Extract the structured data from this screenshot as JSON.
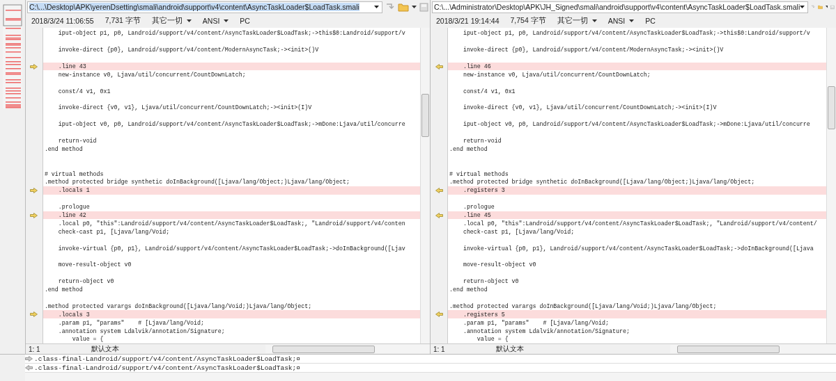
{
  "panes": [
    {
      "kind": "left",
      "path": "C:\\...\\Desktop\\APK\\yerenDsetting\\smali\\android\\support\\v4\\content\\AsyncTaskLoader$LoadTask.smali",
      "path_selected": true,
      "date": "2018/3/24 11:06:55",
      "size": "7,731 字节",
      "filter": "其它一切",
      "encoding": "ANSI",
      "line_ending": "PC",
      "lines": [
        {
          "text": "    iput-object p1, p0, Landroid/support/v4/content/AsyncTaskLoader$LoadTask;->this$0:Landroid/support/v",
          "changed": false
        },
        {
          "changed": false
        },
        {
          "text": "    invoke-direct {p0}, Landroid/support/v4/content/ModernAsyncTask;-><init>()V",
          "changed": false
        },
        {
          "changed": false
        },
        {
          "text": "    .line 43",
          "changed": true
        },
        {
          "text": "    new-instance v0, Ljava/util/concurrent/CountDownLatch;",
          "changed": false
        },
        {
          "changed": false
        },
        {
          "text": "    const/4 v1, 0x1",
          "changed": false
        },
        {
          "changed": false
        },
        {
          "text": "    invoke-direct {v0, v1}, Ljava/util/concurrent/CountDownLatch;-><init>(I)V",
          "changed": false
        },
        {
          "changed": false
        },
        {
          "text": "    iput-object v0, p0, Landroid/support/v4/content/AsyncTaskLoader$LoadTask;->mDone:Ljava/util/concurre",
          "changed": false
        },
        {
          "changed": false
        },
        {
          "text": "    return-void",
          "changed": false
        },
        {
          "text": ".end method",
          "changed": false
        },
        {
          "changed": false
        },
        {
          "changed": false
        },
        {
          "text": "# virtual methods",
          "changed": false
        },
        {
          "text": ".method protected bridge synthetic doInBackground([Ljava/lang/Object;)Ljava/lang/Object;",
          "changed": false
        },
        {
          "text": "    .locals 1",
          "changed": true
        },
        {
          "changed": false
        },
        {
          "text": "    .prologue",
          "changed": false
        },
        {
          "text": "    .line 42",
          "changed": true
        },
        {
          "text": "    .local p0, \"this\":Landroid/support/v4/content/AsyncTaskLoader$LoadTask;, \"Landroid/support/v4/conten",
          "changed": false
        },
        {
          "text": "    check-cast p1, [Ljava/lang/Void;",
          "changed": false
        },
        {
          "changed": false
        },
        {
          "text": "    invoke-virtual {p0, p1}, Landroid/support/v4/content/AsyncTaskLoader$LoadTask;->doInBackground([Ljav",
          "changed": false
        },
        {
          "changed": false
        },
        {
          "text": "    move-result-object v0",
          "changed": false
        },
        {
          "changed": false
        },
        {
          "text": "    return-object v0",
          "changed": false
        },
        {
          "text": ".end method",
          "changed": false
        },
        {
          "changed": false
        },
        {
          "text": ".method protected varargs doInBackground([Ljava/lang/Void;)Ljava/lang/Object;",
          "changed": false
        },
        {
          "text": "    .locals 3",
          "changed": true
        },
        {
          "text": "    .param p1, \"params\"    # [Ljava/lang/Void;",
          "changed": false
        },
        {
          "text": "    .annotation system Ldalvik/annotation/Signature;",
          "changed": false
        },
        {
          "text": "        value = {",
          "changed": false
        }
      ],
      "status": {
        "position": "1: 1",
        "syntax": "默认文本"
      }
    },
    {
      "kind": "right",
      "path": "C:\\...\\Administrator\\Desktop\\APK\\JH_Signed\\smali\\android\\support\\v4\\content\\AsyncTaskLoader$LoadTask.smali",
      "path_selected": false,
      "date": "2018/3/21 19:14:44",
      "size": "7,754 字节",
      "filter": "其它一切",
      "encoding": "ANSI",
      "line_ending": "PC",
      "lines": [
        {
          "text": "    iput-object p1, p0, Landroid/support/v4/content/AsyncTaskLoader$LoadTask;->this$0:Landroid/support/v",
          "changed": false
        },
        {
          "changed": false
        },
        {
          "text": "    invoke-direct {p0}, Landroid/support/v4/content/ModernAsyncTask;-><init>()V",
          "changed": false
        },
        {
          "changed": false
        },
        {
          "text": "    .line 46",
          "changed": true
        },
        {
          "text": "    new-instance v0, Ljava/util/concurrent/CountDownLatch;",
          "changed": false
        },
        {
          "changed": false
        },
        {
          "text": "    const/4 v1, 0x1",
          "changed": false
        },
        {
          "changed": false
        },
        {
          "text": "    invoke-direct {v0, v1}, Ljava/util/concurrent/CountDownLatch;-><init>(I)V",
          "changed": false
        },
        {
          "changed": false
        },
        {
          "text": "    iput-object v0, p0, Landroid/support/v4/content/AsyncTaskLoader$LoadTask;->mDone:Ljava/util/concurre",
          "changed": false
        },
        {
          "changed": false
        },
        {
          "text": "    return-void",
          "changed": false
        },
        {
          "text": ".end method",
          "changed": false
        },
        {
          "changed": false
        },
        {
          "changed": false
        },
        {
          "text": "# virtual methods",
          "changed": false
        },
        {
          "text": ".method protected bridge synthetic doInBackground([Ljava/lang/Object;)Ljava/lang/Object;",
          "changed": false
        },
        {
          "text": "    .registers 3",
          "changed": true
        },
        {
          "changed": false
        },
        {
          "text": "    .prologue",
          "changed": false
        },
        {
          "text": "    .line 45",
          "changed": true
        },
        {
          "text": "    .local p0, \"this\":Landroid/support/v4/content/AsyncTaskLoader$LoadTask;, \"Landroid/support/v4/content/",
          "changed": false
        },
        {
          "text": "    check-cast p1, [Ljava/lang/Void;",
          "changed": false
        },
        {
          "changed": false
        },
        {
          "text": "    invoke-virtual {p0, p1}, Landroid/support/v4/content/AsyncTaskLoader$LoadTask;->doInBackground([Ljava",
          "changed": false
        },
        {
          "changed": false
        },
        {
          "text": "    move-result-object v0",
          "changed": false
        },
        {
          "changed": false
        },
        {
          "text": "    return-object v0",
          "changed": false
        },
        {
          "text": ".end method",
          "changed": false
        },
        {
          "changed": false
        },
        {
          "text": ".method protected varargs doInBackground([Ljava/lang/Void;)Ljava/lang/Object;",
          "changed": false
        },
        {
          "text": "    .registers 5",
          "changed": true
        },
        {
          "text": "    .param p1, \"params\"    # [Ljava/lang/Void;",
          "changed": false
        },
        {
          "text": "    .annotation system Ldalvik/annotation/Signature;",
          "changed": false
        },
        {
          "text": "        value = {",
          "changed": false
        }
      ],
      "status": {
        "position": "1: 1",
        "syntax": "默认文本"
      }
    }
  ],
  "compare_lines": [
    {
      "kind": "left",
      "text": ".class·final·Landroid/support/v4/content/AsyncTaskLoader$LoadTask;¤"
    },
    {
      "kind": "right",
      "text": ".class·final·Landroid/support/v4/content/AsyncTaskLoader$LoadTask;¤"
    }
  ]
}
